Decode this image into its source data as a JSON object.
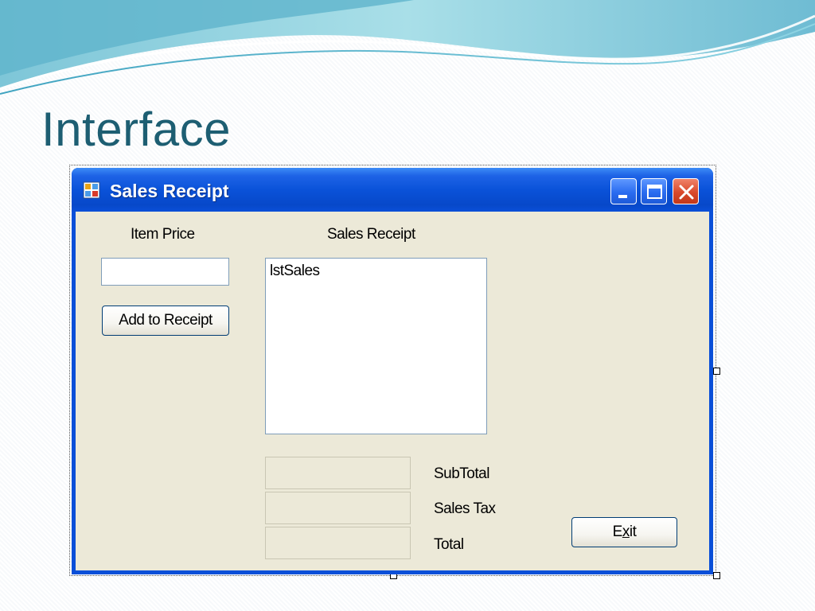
{
  "slide": {
    "title": "Interface"
  },
  "window": {
    "title": "Sales Receipt",
    "caption_buttons": {
      "minimize_icon": "minimize-icon",
      "maximize_icon": "maximize-icon",
      "close_icon": "close-icon"
    }
  },
  "form": {
    "item_price_label": "Item Price",
    "item_price_value": "",
    "add_button_label": "Add to Receipt",
    "sales_receipt_label": "Sales Receipt",
    "listbox_name": "lstSales",
    "subtotal_label": "SubTotal",
    "sales_tax_label": "Sales Tax",
    "total_label": "Total",
    "subtotal_value": "",
    "sales_tax_value": "",
    "total_value": "",
    "exit_button": {
      "mnemonic": "x",
      "before": "E",
      "after": "it"
    }
  },
  "colors": {
    "title_text": "#1d5e72",
    "window_frame": "#0a4fd8",
    "client_bg": "#ece9d8"
  }
}
